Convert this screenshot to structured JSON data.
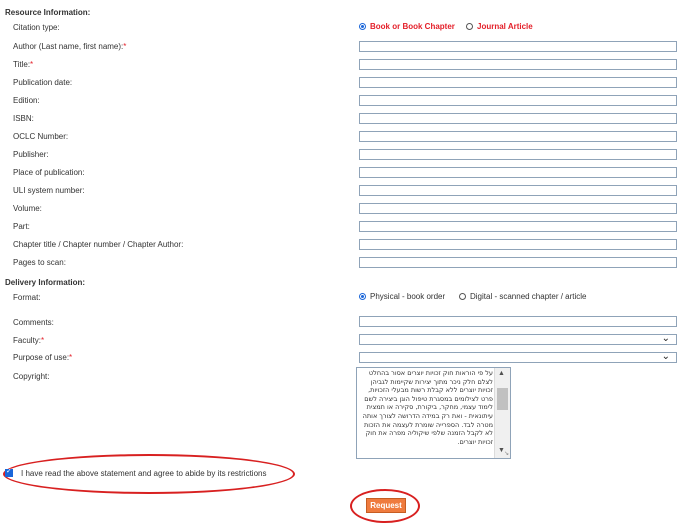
{
  "resource": {
    "heading": "Resource Information:",
    "citation_label": "Citation type:",
    "citation_options": [
      "Book or Book Chapter",
      "Journal Article"
    ],
    "fields": [
      {
        "label": "Author (Last name, first name):",
        "required": true
      },
      {
        "label": "Title:",
        "required": true
      },
      {
        "label": "Publication date:",
        "required": false
      },
      {
        "label": "Edition:",
        "required": false
      },
      {
        "label": "ISBN:",
        "required": false
      },
      {
        "label": "OCLC Number:",
        "required": false
      },
      {
        "label": "Publisher:",
        "required": false
      },
      {
        "label": "Place of publication:",
        "required": false
      },
      {
        "label": "ULI system number:",
        "required": false
      },
      {
        "label": "Volume:",
        "required": false
      },
      {
        "label": "Part:",
        "required": false
      },
      {
        "label": "Chapter title / Chapter number / Chapter Author:",
        "required": false
      },
      {
        "label": "Pages to scan:",
        "required": false
      }
    ]
  },
  "delivery": {
    "heading": "Delivery Information:",
    "format_label": "Format:",
    "format_options": [
      "Physical - book order",
      "Digital - scanned chapter / article"
    ],
    "comments_label": "Comments:",
    "faculty_label": "Faculty:",
    "purpose_label": "Purpose of use:",
    "copyright_label": "Copyright:",
    "copyright_text": "על פי הוראות חוק זכויות יוצרים אסור בהחלט לצלם חלק ניכר מתוך יצירות שקיימות לגביהן זכויות יוצרים ללא קבלת רשות מבעלי הזכויות, פרט לצילומים במסגרת טיפול הוגן ביצירה לשם לימוד עצמי, מחקר, ביקורת, סקירה או תמצית עיתונאית - ואת רק במידה הדרושה לצורך אותה מטרה לבד. הספרייה שומרת לעצמה את הזכות לא לקבל הזמנה שלפי שיקוליה מפרה את חוק זכויות יוצרים."
  },
  "agree_text": "I have read the above statement and agree to abide by its restrictions",
  "request_label": "Request",
  "required_mark": "*"
}
